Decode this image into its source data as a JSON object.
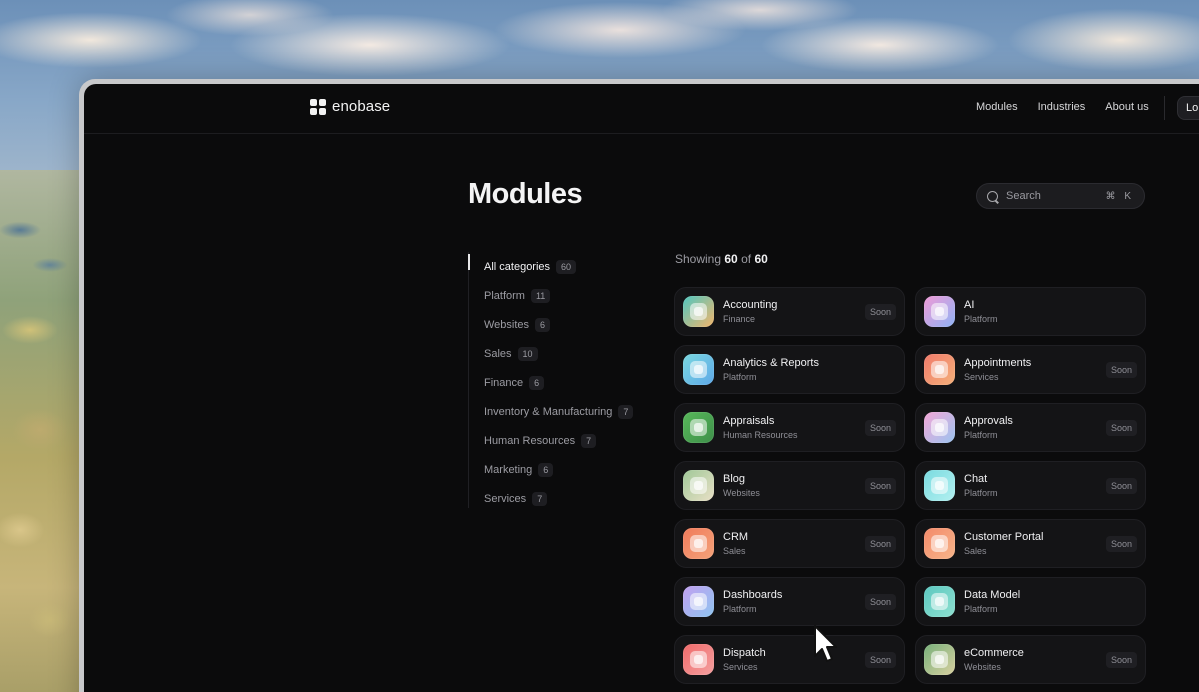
{
  "header": {
    "brand": "enobase",
    "nav": [
      "Modules",
      "Industries",
      "About us"
    ],
    "login_label": "Lo"
  },
  "page": {
    "title": "Modules",
    "search": {
      "placeholder": "Search",
      "shortcut": "⌘ K"
    }
  },
  "categories": [
    {
      "label": "All categories",
      "count": "60",
      "active": true
    },
    {
      "label": "Platform",
      "count": "11"
    },
    {
      "label": "Websites",
      "count": "6"
    },
    {
      "label": "Sales",
      "count": "10"
    },
    {
      "label": "Finance",
      "count": "6"
    },
    {
      "label": "Inventory & Manufacturing",
      "count": "7"
    },
    {
      "label": "Human Resources",
      "count": "7"
    },
    {
      "label": "Marketing",
      "count": "6"
    },
    {
      "label": "Services",
      "count": "7"
    }
  ],
  "results": {
    "prefix": "Showing",
    "shown": "60",
    "of": "of",
    "total": "60"
  },
  "modules": [
    {
      "name": "Accounting",
      "category": "Finance",
      "badge": "Soon",
      "icon": "accounting-icon",
      "colors": [
        "#4fc7c0",
        "#f2b56b"
      ]
    },
    {
      "name": "AI",
      "category": "Platform",
      "badge": "",
      "icon": "ai-icon",
      "colors": [
        "#f09ad6",
        "#8fb3f5"
      ]
    },
    {
      "name": "Analytics & Reports",
      "category": "Platform",
      "badge": "",
      "icon": "analytics-icon",
      "colors": [
        "#7ad8e0",
        "#5ea8e8"
      ]
    },
    {
      "name": "Appointments",
      "category": "Services",
      "badge": "Soon",
      "icon": "calendar-icon",
      "colors": [
        "#f07a6a",
        "#f4b07a"
      ]
    },
    {
      "name": "Appraisals",
      "category": "Human Resources",
      "badge": "Soon",
      "icon": "award-icon",
      "colors": [
        "#58b85a",
        "#3e8f4a"
      ]
    },
    {
      "name": "Approvals",
      "category": "Platform",
      "badge": "Soon",
      "icon": "approvals-icon",
      "colors": [
        "#f3a6d6",
        "#9bc4f0"
      ]
    },
    {
      "name": "Blog",
      "category": "Websites",
      "badge": "Soon",
      "icon": "blog-icon",
      "colors": [
        "#a0c898",
        "#e9e0c6"
      ]
    },
    {
      "name": "Chat",
      "category": "Platform",
      "badge": "Soon",
      "icon": "chat-icon",
      "colors": [
        "#7adbe0",
        "#b3f0f0"
      ]
    },
    {
      "name": "CRM",
      "category": "Sales",
      "badge": "Soon",
      "icon": "crm-icon",
      "colors": [
        "#f07a5a",
        "#f4a37a"
      ]
    },
    {
      "name": "Customer Portal",
      "category": "Sales",
      "badge": "Soon",
      "icon": "portal-icon",
      "colors": [
        "#f48a6a",
        "#f6b58a"
      ]
    },
    {
      "name": "Dashboards",
      "category": "Platform",
      "badge": "Soon",
      "icon": "dashboards-icon",
      "colors": [
        "#c2a0f0",
        "#8ec4f0"
      ]
    },
    {
      "name": "Data Model",
      "category": "Platform",
      "badge": "",
      "icon": "data-model-icon",
      "colors": [
        "#5cc8c0",
        "#8ee0d0"
      ]
    },
    {
      "name": "Dispatch",
      "category": "Services",
      "badge": "Soon",
      "icon": "dispatch-icon",
      "colors": [
        "#f06a6a",
        "#f4a0a0"
      ]
    },
    {
      "name": "eCommerce",
      "category": "Websites",
      "badge": "Soon",
      "icon": "basket-icon",
      "colors": [
        "#78b07a",
        "#d8d0a0"
      ]
    }
  ]
}
